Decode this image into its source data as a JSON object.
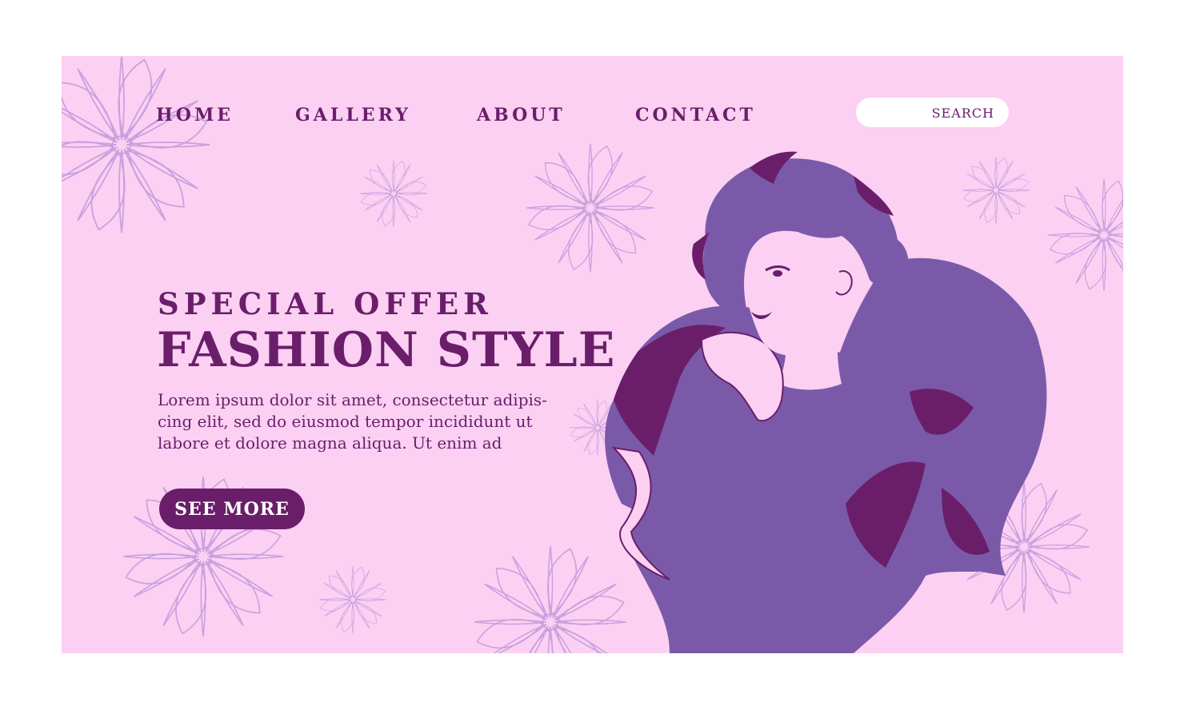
{
  "nav": {
    "items": [
      "HOME",
      "GALLERY",
      "ABOUT",
      "CONTACT"
    ],
    "search_label": "SEARCH"
  },
  "hero": {
    "kicker": "SPECIAL OFFER",
    "headline": "FASHION STYLE",
    "body": "Lorem ipsum dolor sit amet, consectetur adipis-cing elit, sed do eiusmod tempor incididunt ut labore et dolore magna aliqua. Ut enim ad",
    "cta_label": "SEE MORE"
  },
  "colors": {
    "background": "#fbd0f3",
    "primary": "#6a1e6a",
    "secondary": "#7a5aa8",
    "flower_outline": "#c9a2de",
    "skin": "#fbd0f3"
  },
  "icons": [
    "flower-decoration-icon",
    "search-icon",
    "woman-illustration"
  ]
}
